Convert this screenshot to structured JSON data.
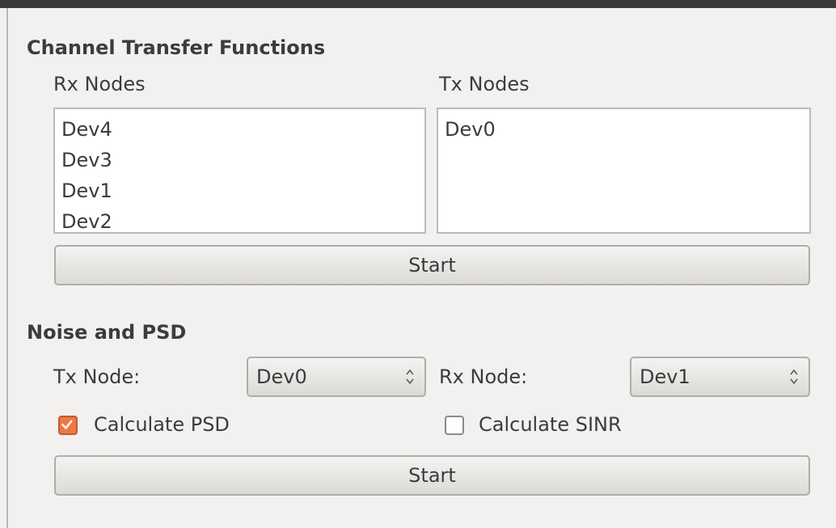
{
  "channel_transfer": {
    "title": "Channel Transfer Functions",
    "rx_label": "Rx Nodes",
    "tx_label": "Tx Nodes",
    "rx_items": [
      "Dev4",
      "Dev3",
      "Dev1",
      "Dev2"
    ],
    "tx_items": [
      "Dev0"
    ],
    "start_label": "Start"
  },
  "noise_psd": {
    "title": "Noise and PSD",
    "tx_node_label": "Tx Node:",
    "tx_node_value": "Dev0",
    "rx_node_label": "Rx Node:",
    "rx_node_value": "Dev1",
    "calc_psd_label": "Calculate PSD",
    "calc_psd_checked": true,
    "calc_sinr_label": "Calculate SINR",
    "calc_sinr_checked": false,
    "start_label": "Start"
  },
  "colors": {
    "accent": "#f07746",
    "background": "#f2f1f0"
  }
}
